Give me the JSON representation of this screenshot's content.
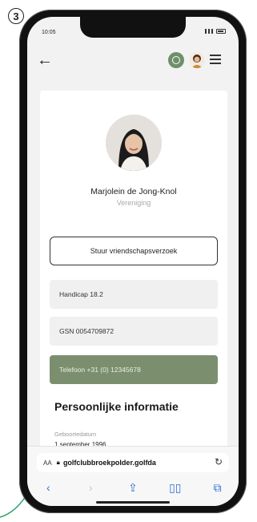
{
  "step": {
    "number": "3"
  },
  "status_bar": {
    "time": "10:05"
  },
  "topbar": {
    "back_icon": "back-arrow-icon",
    "group_icon": "group-icon",
    "avatar_icon": "user-avatar-icon",
    "menu_icon": "hamburger-menu-icon"
  },
  "profile": {
    "name": "Marjolein de Jong-Knol",
    "role": "Vereniging",
    "friend_request_label": "Stuur vriendschapsverzoek",
    "handicap": "Handicap 18.2",
    "gsn": "GSN 0054709872",
    "phone": "Telefoon +31 (0) 12345678"
  },
  "personal_info": {
    "title": "Persoonlijke informatie",
    "dob_label": "Geboortedatum",
    "dob_value": "1 september 1996"
  },
  "browser": {
    "aa_label": "AA",
    "url": "golfclubbroekpolder.golfda",
    "reload_icon": "reload-icon",
    "toolbar": {
      "back": "‹",
      "forward": "›",
      "share": "⇪",
      "bookmarks": "▯▯",
      "tabs": "⧉"
    }
  },
  "colors": {
    "accent_green": "#7b8f6e",
    "link_blue": "#2f6fd6"
  }
}
